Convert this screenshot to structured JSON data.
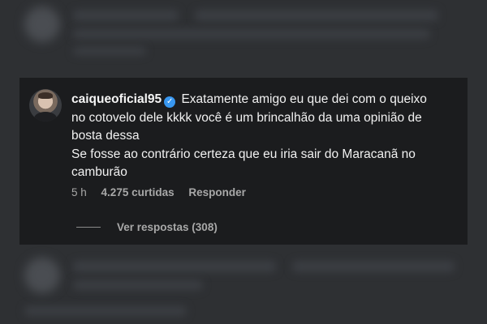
{
  "comment": {
    "username": "caiqueoficial95",
    "verified_icon": "verified-badge-icon",
    "text_lines": [
      "Exatamente amigo eu que dei com o queixo",
      "no cotovelo dele kkkk você é um brincalhão da uma opinião de",
      "bosta dessa",
      "Se fosse ao contrário certeza que eu iria sair do Maracanã no",
      "camburão"
    ],
    "time": "5 h",
    "likes": "4.275 curtidas",
    "reply_label": "Responder",
    "view_replies_label": "Ver respostas (308)"
  },
  "colors": {
    "background": "#2e3033",
    "panel": "#1b1c1e",
    "text": "#f1f1f1",
    "muted": "#a8a8a8",
    "verified": "#3897f0"
  }
}
